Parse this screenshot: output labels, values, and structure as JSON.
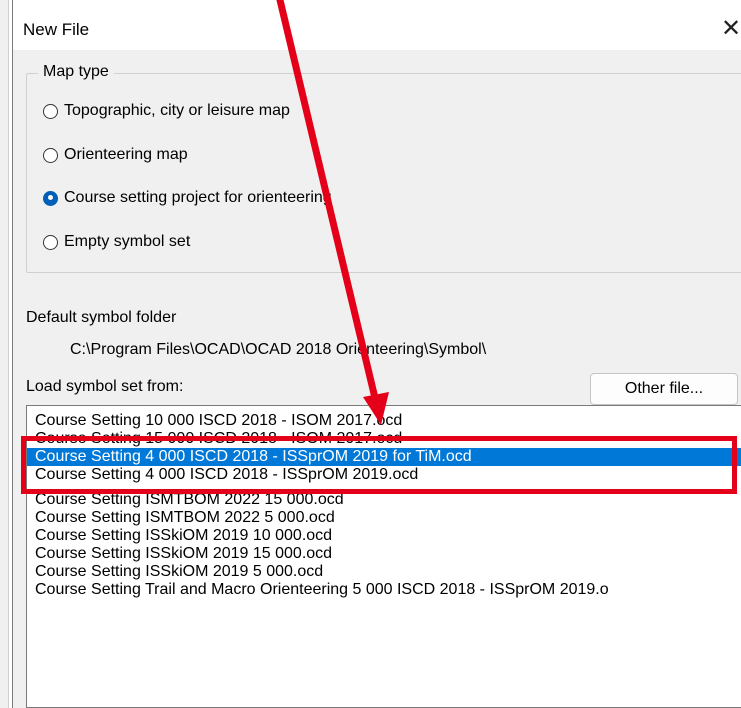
{
  "dialog": {
    "title": "New File",
    "close_glyph": "✕"
  },
  "map_type": {
    "legend": "Map type",
    "options": [
      {
        "label": "Topographic, city or leisure map",
        "checked": false
      },
      {
        "label": "Orienteering map",
        "checked": false
      },
      {
        "label": "Course setting project for orienteering",
        "checked": true
      },
      {
        "label": "Empty symbol set",
        "checked": false
      }
    ]
  },
  "symbol_folder": {
    "label": "Default symbol folder",
    "path": "C:\\Program Files\\OCAD\\OCAD 2018 Orienteering\\Symbol\\"
  },
  "load_symbol_set": {
    "label": "Load symbol set from:",
    "other_file_button": "Other file..."
  },
  "symbol_files": [
    {
      "name": "Course Setting 10 000 ISCD 2018 - ISOM 2017.ocd",
      "selected": false
    },
    {
      "name": "Course Setting 15 000 ISCD 2018 - ISOM 2017.ocd",
      "selected": false
    },
    {
      "name": "Course Setting 4 000 ISCD 2018 - ISSprOM 2019 for TiM.ocd",
      "selected": true
    },
    {
      "name": "Course Setting 4 000 ISCD 2018 - ISSprOM 2019.ocd",
      "selected": false
    },
    {
      "name": "Course Setting ISMTBOM 2022 15 000.ocd",
      "selected": false
    },
    {
      "name": "Course Setting ISMTBOM 2022 5 000.ocd",
      "selected": false
    },
    {
      "name": "Course Setting ISSkiOM 2019 10 000.ocd",
      "selected": false
    },
    {
      "name": "Course Setting ISSkiOM 2019 15 000.ocd",
      "selected": false
    },
    {
      "name": "Course Setting ISSkiOM 2019 5 000.ocd",
      "selected": false
    },
    {
      "name": "Course Setting Trail and Macro Orienteering 5 000 ISCD 2018 - ISSprOM 2019.o",
      "selected": false
    }
  ],
  "annotation": {
    "color": "#e5001a",
    "arrow_icon": "red-arrow-icon",
    "box": "highlight-box"
  }
}
